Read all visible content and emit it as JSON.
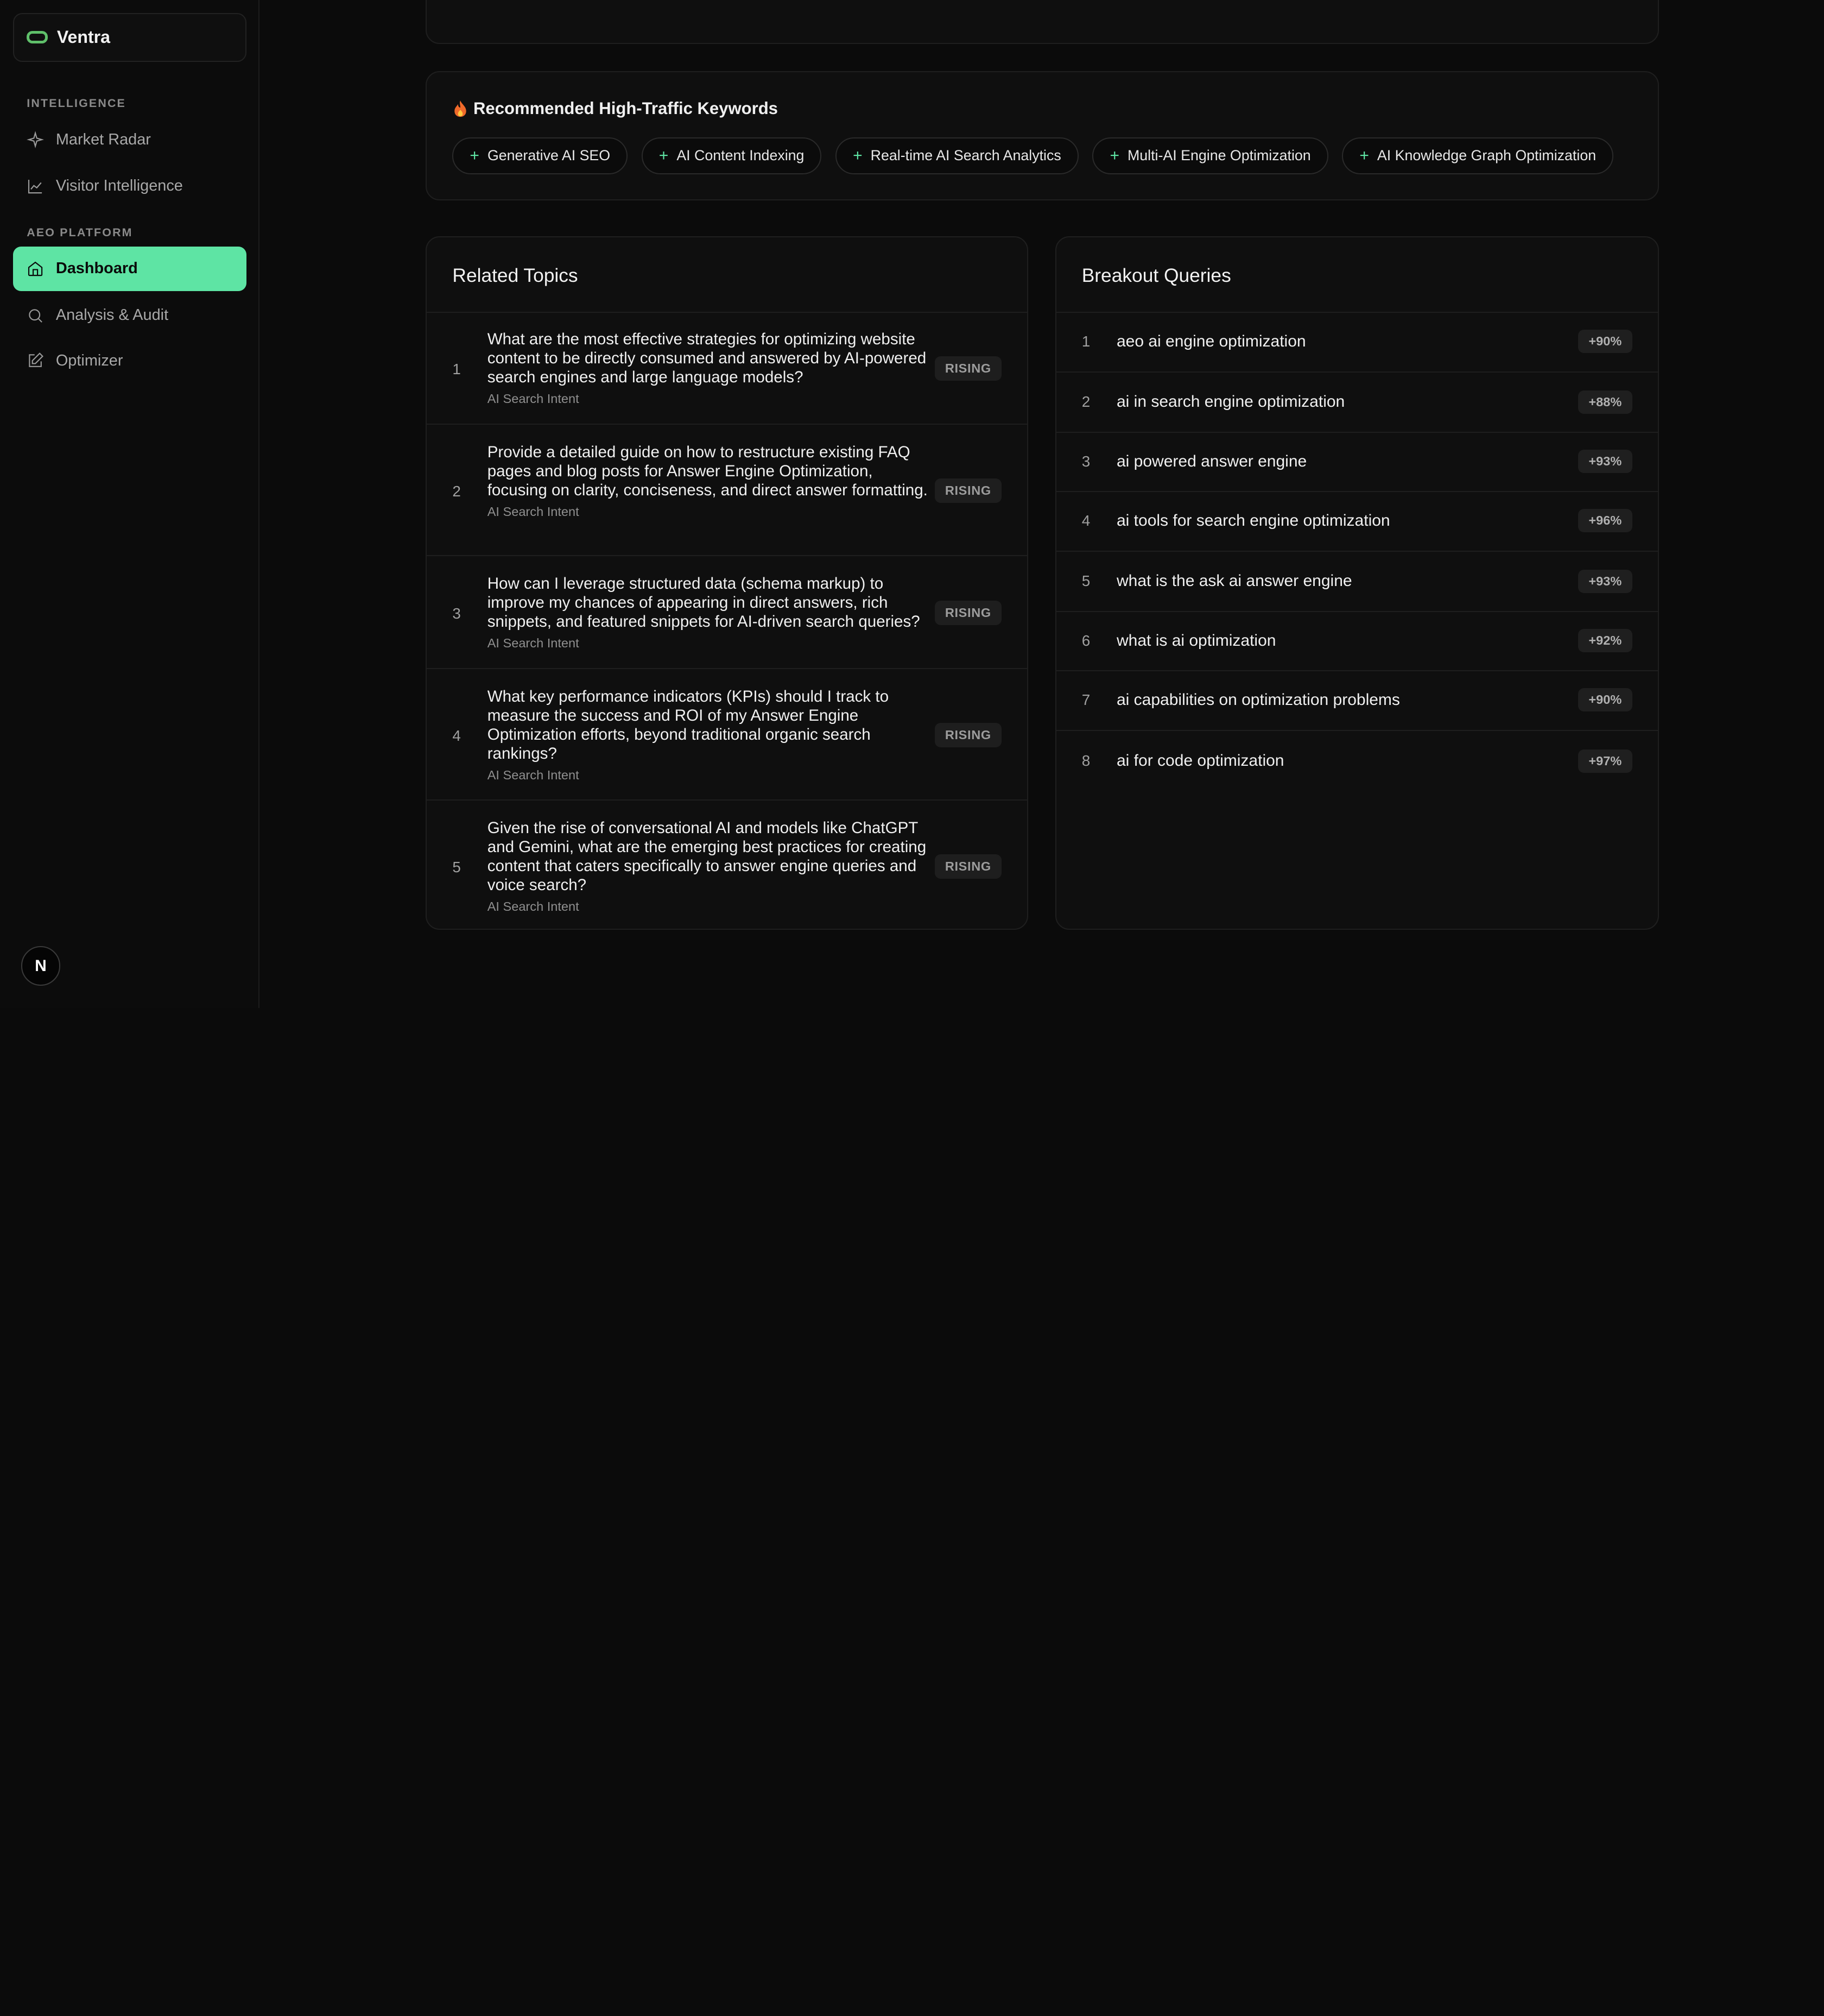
{
  "brand": {
    "name": "Ventra"
  },
  "sidebar": {
    "sections": [
      {
        "label": "INTELLIGENCE"
      },
      {
        "label": "AEO PLATFORM"
      }
    ],
    "items": [
      {
        "label": "Market Radar",
        "icon": "sparkle-icon"
      },
      {
        "label": "Visitor Intelligence",
        "icon": "line-chart-icon"
      },
      {
        "label": "Dashboard",
        "icon": "home-icon",
        "active": true
      },
      {
        "label": "Analysis & Audit",
        "icon": "search-icon"
      },
      {
        "label": "Optimizer",
        "icon": "edit-icon"
      }
    ],
    "footer_badge": "N"
  },
  "keywords": {
    "title": "Recommended High-Traffic Keywords",
    "icon": "fire-icon",
    "chips": [
      "Generative AI SEO",
      "AI Content Indexing",
      "Real-time AI Search Analytics",
      "Multi-AI Engine Optimization",
      "AI Knowledge Graph Optimization"
    ]
  },
  "related_topics": {
    "title": "Related Topics",
    "items": [
      {
        "num": "1",
        "question": "What are the most effective strategies for optimizing website content to be directly consumed and answered by AI-powered search engines and large language models?",
        "intent": "AI Search Intent",
        "badge": "RISING"
      },
      {
        "num": "2",
        "question": "Provide a detailed guide on how to restructure existing FAQ pages and blog posts for Answer Engine Optimization, focusing on clarity, conciseness, and direct answer formatting.",
        "intent": "AI Search Intent",
        "badge": "RISING"
      },
      {
        "num": "3",
        "question": "How can I leverage structured data (schema markup) to improve my chances of appearing in direct answers, rich snippets, and featured snippets for AI-driven search queries?",
        "intent": "AI Search Intent",
        "badge": "RISING"
      },
      {
        "num": "4",
        "question": "What key performance indicators (KPIs) should I track to measure the success and ROI of my Answer Engine Optimization efforts, beyond traditional organic search rankings?",
        "intent": "AI Search Intent",
        "badge": "RISING"
      },
      {
        "num": "5",
        "question": "Given the rise of conversational AI and models like ChatGPT and Gemini, what are the emerging best practices for creating content that caters specifically to answer engine queries and voice search?",
        "intent": "AI Search Intent",
        "badge": "RISING"
      }
    ]
  },
  "breakout_queries": {
    "title": "Breakout Queries",
    "items": [
      {
        "num": "1",
        "query": "aeo ai engine optimization",
        "change": "+90%"
      },
      {
        "num": "2",
        "query": "ai in search engine optimization",
        "change": "+88%"
      },
      {
        "num": "3",
        "query": "ai powered answer engine",
        "change": "+93%"
      },
      {
        "num": "4",
        "query": "ai tools for search engine optimization",
        "change": "+96%"
      },
      {
        "num": "5",
        "query": "what is the ask ai answer engine",
        "change": "+93%"
      },
      {
        "num": "6",
        "query": "what is ai optimization",
        "change": "+92%"
      },
      {
        "num": "7",
        "query": "ai capabilities on optimization problems",
        "change": "+90%"
      },
      {
        "num": "8",
        "query": "ai for code optimization",
        "change": "+97%"
      }
    ]
  },
  "colors": {
    "accent": "#5ee4a4",
    "background": "#0b0b0b",
    "card": "#0f0f0f"
  }
}
